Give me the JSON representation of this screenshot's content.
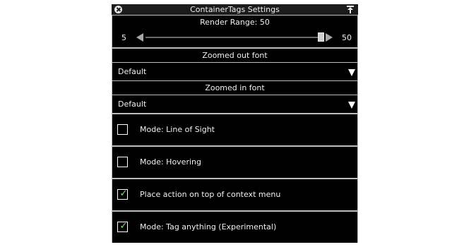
{
  "window": {
    "title": "ContainerTags Settings"
  },
  "slider": {
    "title": "Render Range: 50",
    "min_label": "5",
    "max_label": "50",
    "value_fraction": 1.0
  },
  "zoomed_out": {
    "header": "Zoomed out font",
    "value": "Default"
  },
  "zoomed_in": {
    "header": "Zoomed in font",
    "value": "Default"
  },
  "options": [
    {
      "label": "Mode: Line of Sight",
      "checked": false
    },
    {
      "label": "Mode: Hovering",
      "checked": false
    },
    {
      "label": "Place action on top of context menu",
      "checked": true
    },
    {
      "label": "Mode: Tag anything (Experimental)",
      "checked": true
    }
  ],
  "icons": {
    "close": "close-icon",
    "pin": "pin-icon",
    "dropdown": "triangle-down-icon",
    "check": "checkmark-icon"
  },
  "colors": {
    "panel_bg": "#000000",
    "border": "#bdbdbd",
    "check": "#7fe07f"
  }
}
